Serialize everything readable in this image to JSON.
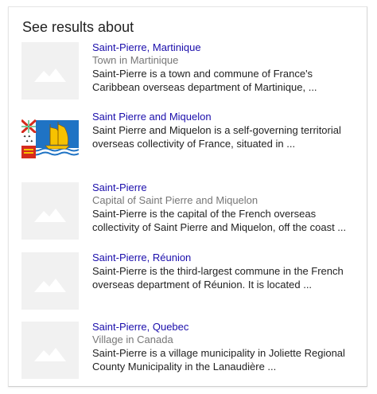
{
  "panel": {
    "title": "See results about"
  },
  "results": [
    {
      "title": "Saint-Pierre, Martinique",
      "subtitle": "Town in Martinique",
      "desc_line1": "Saint-Pierre is a town and commune of France's",
      "desc_line2": "Caribbean overseas department of Martinique, ...",
      "thumbnail": "placeholder-mountain-icon"
    },
    {
      "title": "Saint Pierre and Miquelon",
      "subtitle": "",
      "desc_line1": "Saint Pierre and Miquelon is a self-governing territorial",
      "desc_line2": "overseas collectivity of France, situated in ...",
      "thumbnail": "flag-saint-pierre-and-miquelon"
    },
    {
      "title": "Saint-Pierre",
      "subtitle": "Capital of Saint Pierre and Miquelon",
      "desc_line1": "Saint-Pierre is the capital of the French overseas",
      "desc_line2": "collectivity of Saint Pierre and Miquelon, off the coast ...",
      "thumbnail": "placeholder-mountain-icon"
    },
    {
      "title": "Saint-Pierre, Réunion",
      "subtitle": "",
      "desc_line1": "Saint-Pierre is the third-largest commune in the French",
      "desc_line2": "overseas department of Réunion. It is located ...",
      "thumbnail": "placeholder-mountain-icon"
    },
    {
      "title": "Saint-Pierre, Quebec",
      "subtitle": "Village in Canada",
      "desc_line1": "Saint-Pierre is a village municipality in Joliette Regional",
      "desc_line2": "County Municipality in the Lanaudière ...",
      "thumbnail": "placeholder-mountain-icon"
    }
  ],
  "colors": {
    "link": "#1a0dab",
    "subtitle": "#777777",
    "body_text": "#222222",
    "placeholder_bg": "#f1f1f1",
    "placeholder_shape": "#ffffff",
    "flag_blue": "#1f73c4",
    "flag_yellow": "#f7c200"
  }
}
